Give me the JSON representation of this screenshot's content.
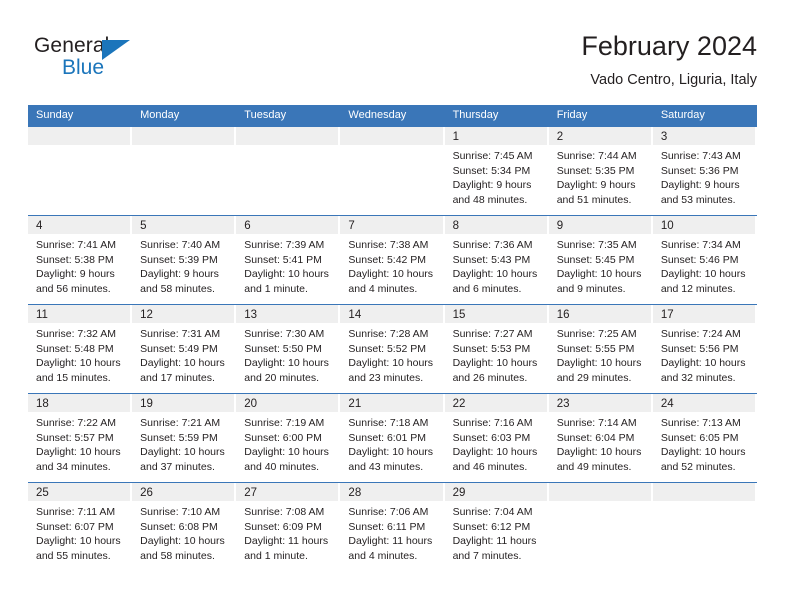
{
  "brand": {
    "name_part1": "General",
    "name_part2": "Blue",
    "triangle_color": "#1b75bb"
  },
  "header": {
    "month_title": "February 2024",
    "location": "Vado Centro, Liguria, Italy"
  },
  "theme": {
    "header_blue": "#3a76b8",
    "date_band_gray": "#efefef",
    "text_dark": "#231f20"
  },
  "calendar": {
    "weekdays": [
      "Sunday",
      "Monday",
      "Tuesday",
      "Wednesday",
      "Thursday",
      "Friday",
      "Saturday"
    ],
    "weeks": [
      [
        {
          "day": "",
          "sunrise": "",
          "sunset": "",
          "daylight": ""
        },
        {
          "day": "",
          "sunrise": "",
          "sunset": "",
          "daylight": ""
        },
        {
          "day": "",
          "sunrise": "",
          "sunset": "",
          "daylight": ""
        },
        {
          "day": "",
          "sunrise": "",
          "sunset": "",
          "daylight": ""
        },
        {
          "day": "1",
          "sunrise": "Sunrise: 7:45 AM",
          "sunset": "Sunset: 5:34 PM",
          "daylight": "Daylight: 9 hours and 48 minutes."
        },
        {
          "day": "2",
          "sunrise": "Sunrise: 7:44 AM",
          "sunset": "Sunset: 5:35 PM",
          "daylight": "Daylight: 9 hours and 51 minutes."
        },
        {
          "day": "3",
          "sunrise": "Sunrise: 7:43 AM",
          "sunset": "Sunset: 5:36 PM",
          "daylight": "Daylight: 9 hours and 53 minutes."
        }
      ],
      [
        {
          "day": "4",
          "sunrise": "Sunrise: 7:41 AM",
          "sunset": "Sunset: 5:38 PM",
          "daylight": "Daylight: 9 hours and 56 minutes."
        },
        {
          "day": "5",
          "sunrise": "Sunrise: 7:40 AM",
          "sunset": "Sunset: 5:39 PM",
          "daylight": "Daylight: 9 hours and 58 minutes."
        },
        {
          "day": "6",
          "sunrise": "Sunrise: 7:39 AM",
          "sunset": "Sunset: 5:41 PM",
          "daylight": "Daylight: 10 hours and 1 minute."
        },
        {
          "day": "7",
          "sunrise": "Sunrise: 7:38 AM",
          "sunset": "Sunset: 5:42 PM",
          "daylight": "Daylight: 10 hours and 4 minutes."
        },
        {
          "day": "8",
          "sunrise": "Sunrise: 7:36 AM",
          "sunset": "Sunset: 5:43 PM",
          "daylight": "Daylight: 10 hours and 6 minutes."
        },
        {
          "day": "9",
          "sunrise": "Sunrise: 7:35 AM",
          "sunset": "Sunset: 5:45 PM",
          "daylight": "Daylight: 10 hours and 9 minutes."
        },
        {
          "day": "10",
          "sunrise": "Sunrise: 7:34 AM",
          "sunset": "Sunset: 5:46 PM",
          "daylight": "Daylight: 10 hours and 12 minutes."
        }
      ],
      [
        {
          "day": "11",
          "sunrise": "Sunrise: 7:32 AM",
          "sunset": "Sunset: 5:48 PM",
          "daylight": "Daylight: 10 hours and 15 minutes."
        },
        {
          "day": "12",
          "sunrise": "Sunrise: 7:31 AM",
          "sunset": "Sunset: 5:49 PM",
          "daylight": "Daylight: 10 hours and 17 minutes."
        },
        {
          "day": "13",
          "sunrise": "Sunrise: 7:30 AM",
          "sunset": "Sunset: 5:50 PM",
          "daylight": "Daylight: 10 hours and 20 minutes."
        },
        {
          "day": "14",
          "sunrise": "Sunrise: 7:28 AM",
          "sunset": "Sunset: 5:52 PM",
          "daylight": "Daylight: 10 hours and 23 minutes."
        },
        {
          "day": "15",
          "sunrise": "Sunrise: 7:27 AM",
          "sunset": "Sunset: 5:53 PM",
          "daylight": "Daylight: 10 hours and 26 minutes."
        },
        {
          "day": "16",
          "sunrise": "Sunrise: 7:25 AM",
          "sunset": "Sunset: 5:55 PM",
          "daylight": "Daylight: 10 hours and 29 minutes."
        },
        {
          "day": "17",
          "sunrise": "Sunrise: 7:24 AM",
          "sunset": "Sunset: 5:56 PM",
          "daylight": "Daylight: 10 hours and 32 minutes."
        }
      ],
      [
        {
          "day": "18",
          "sunrise": "Sunrise: 7:22 AM",
          "sunset": "Sunset: 5:57 PM",
          "daylight": "Daylight: 10 hours and 34 minutes."
        },
        {
          "day": "19",
          "sunrise": "Sunrise: 7:21 AM",
          "sunset": "Sunset: 5:59 PM",
          "daylight": "Daylight: 10 hours and 37 minutes."
        },
        {
          "day": "20",
          "sunrise": "Sunrise: 7:19 AM",
          "sunset": "Sunset: 6:00 PM",
          "daylight": "Daylight: 10 hours and 40 minutes."
        },
        {
          "day": "21",
          "sunrise": "Sunrise: 7:18 AM",
          "sunset": "Sunset: 6:01 PM",
          "daylight": "Daylight: 10 hours and 43 minutes."
        },
        {
          "day": "22",
          "sunrise": "Sunrise: 7:16 AM",
          "sunset": "Sunset: 6:03 PM",
          "daylight": "Daylight: 10 hours and 46 minutes."
        },
        {
          "day": "23",
          "sunrise": "Sunrise: 7:14 AM",
          "sunset": "Sunset: 6:04 PM",
          "daylight": "Daylight: 10 hours and 49 minutes."
        },
        {
          "day": "24",
          "sunrise": "Sunrise: 7:13 AM",
          "sunset": "Sunset: 6:05 PM",
          "daylight": "Daylight: 10 hours and 52 minutes."
        }
      ],
      [
        {
          "day": "25",
          "sunrise": "Sunrise: 7:11 AM",
          "sunset": "Sunset: 6:07 PM",
          "daylight": "Daylight: 10 hours and 55 minutes."
        },
        {
          "day": "26",
          "sunrise": "Sunrise: 7:10 AM",
          "sunset": "Sunset: 6:08 PM",
          "daylight": "Daylight: 10 hours and 58 minutes."
        },
        {
          "day": "27",
          "sunrise": "Sunrise: 7:08 AM",
          "sunset": "Sunset: 6:09 PM",
          "daylight": "Daylight: 11 hours and 1 minute."
        },
        {
          "day": "28",
          "sunrise": "Sunrise: 7:06 AM",
          "sunset": "Sunset: 6:11 PM",
          "daylight": "Daylight: 11 hours and 4 minutes."
        },
        {
          "day": "29",
          "sunrise": "Sunrise: 7:04 AM",
          "sunset": "Sunset: 6:12 PM",
          "daylight": "Daylight: 11 hours and 7 minutes."
        },
        {
          "day": "",
          "sunrise": "",
          "sunset": "",
          "daylight": ""
        },
        {
          "day": "",
          "sunrise": "",
          "sunset": "",
          "daylight": ""
        }
      ]
    ]
  }
}
